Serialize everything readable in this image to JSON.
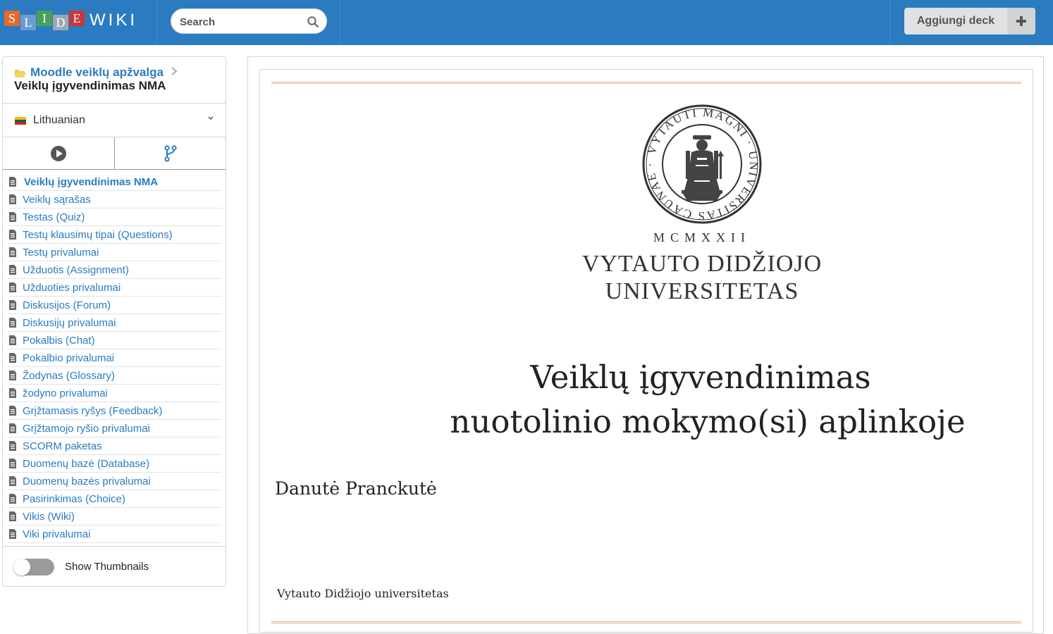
{
  "header": {
    "logo_letters": [
      "S",
      "L",
      "I",
      "D",
      "E"
    ],
    "logo_suffix": "WIKI",
    "search_placeholder": "Search",
    "add_deck_label": "Aggiungi deck",
    "add_deck_icon": "plus-icon",
    "brand_color": "#2b7bc0"
  },
  "sidebar": {
    "breadcrumb_parent": "Moodle veiklų apžvalga",
    "breadcrumb_current": "Veiklų įgyvendinimas NMA",
    "language": "Lithuanian",
    "tabs": [
      {
        "icon": "play-icon"
      },
      {
        "icon": "fork-icon"
      }
    ],
    "slides": [
      {
        "label": "Veiklų įgyvendinimas NMA",
        "active": true
      },
      {
        "label": "Veiklų sąrašas"
      },
      {
        "label": "Testas (Quiz)"
      },
      {
        "label": "Testų klausimų tipai (Questions)"
      },
      {
        "label": "Testų privalumai"
      },
      {
        "label": "Užduotis (Assignment)"
      },
      {
        "label": "Užduoties privalumai"
      },
      {
        "label": "Diskusijos (Forum)"
      },
      {
        "label": "Diskusijų privalumai"
      },
      {
        "label": "Pokalbis (Chat)"
      },
      {
        "label": "Pokalbio privalumai"
      },
      {
        "label": "Žodynas (Glossary)"
      },
      {
        "label": "žodyno privalumai"
      },
      {
        "label": "Grįžtamasis ryšys (Feedback)"
      },
      {
        "label": "Grįžtamojo ryšio privalumai"
      },
      {
        "label": "SCORM paketas"
      },
      {
        "label": "Duomenų bazė (Database)"
      },
      {
        "label": "Duomenų bazės privalumai"
      },
      {
        "label": "Pasirinkimas (Choice)"
      },
      {
        "label": "Vikis (Wiki)"
      },
      {
        "label": "Viki privalumai"
      }
    ],
    "show_thumbnails_label": "Show Thumbnails",
    "show_thumbnails_on": false
  },
  "slide": {
    "seal_text": "VYTAUTI MAGNI UNIVERSITAS CAUNAE",
    "roman_year": "MCMXXII",
    "university_line1": "VYTAUTO DIDŽIOJO",
    "university_line2": "UNIVERSITETAS",
    "title_line1": "Veiklų įgyvendinimas",
    "title_line2": "nuotolinio mokymo(si) aplinkoje",
    "author": "Danutė Pranckutė",
    "footer": "Vytauto Didžiojo universitetas",
    "rule_color": "#e6b197"
  }
}
